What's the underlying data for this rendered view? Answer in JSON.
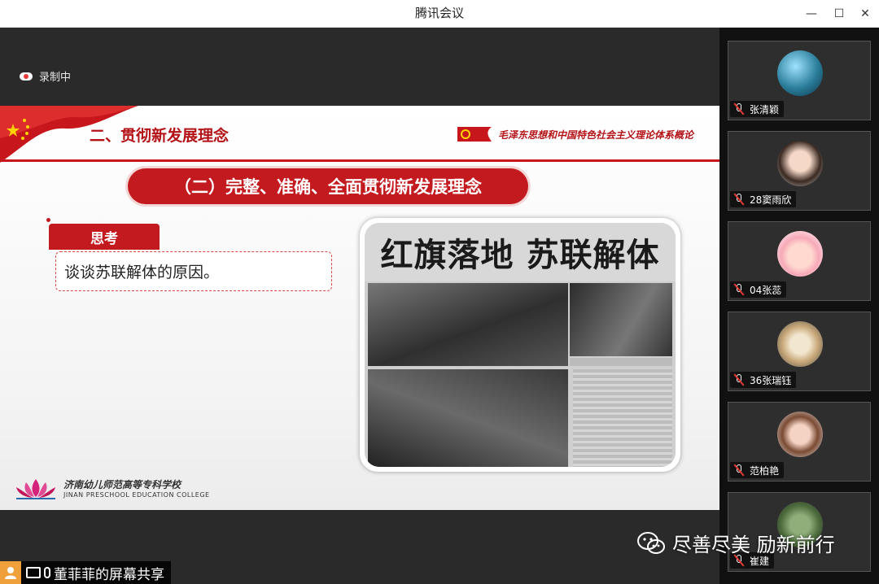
{
  "window": {
    "title": "腾讯会议",
    "minimize_label": "—",
    "maximize_label": "☐",
    "close_label": "✕"
  },
  "recording": {
    "label": "录制中"
  },
  "slide": {
    "section_title": "二、贯彻新发展理念",
    "header_right": "毛泽东思想和中国特色社会主义理论体系概论",
    "subtitle": "（二）完整、准确、全面贯彻新发展理念",
    "think_label": "思考",
    "question": "谈谈苏联解体的原因。",
    "photo_headline": "红旗落地 苏联解体",
    "logo_cn": "济南幼儿师范高等专科学校",
    "logo_en": "JINAN PRESCHOOL EDUCATION COLLEGE"
  },
  "share_bar": {
    "label": "董菲菲的屏幕共享"
  },
  "participants": [
    {
      "name": "张清颖"
    },
    {
      "name": "28窦雨欣"
    },
    {
      "name": "04张蕊"
    },
    {
      "name": "36张瑞钰"
    },
    {
      "name": "范柏艳"
    },
    {
      "name": "崔建"
    }
  ],
  "watermark": {
    "text": "尽善尽美 励新前行"
  },
  "colors": {
    "accent_red": "#c31a1f",
    "titlebar": "#ffffff",
    "background": "#2a2a2a"
  }
}
